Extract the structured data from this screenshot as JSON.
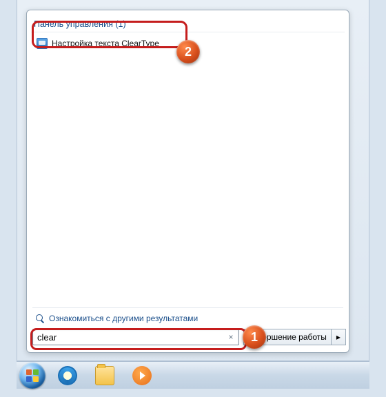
{
  "category": {
    "label": "Панель управления",
    "count": 1
  },
  "result": {
    "label": "Настройка текста ClearType"
  },
  "more_results": "Ознакомиться с другими результатами",
  "search": {
    "value": "clear",
    "clear_glyph": "×"
  },
  "shutdown": {
    "label": "Завершение работы",
    "arrow": "▸"
  },
  "badges": {
    "one": "1",
    "two": "2"
  }
}
